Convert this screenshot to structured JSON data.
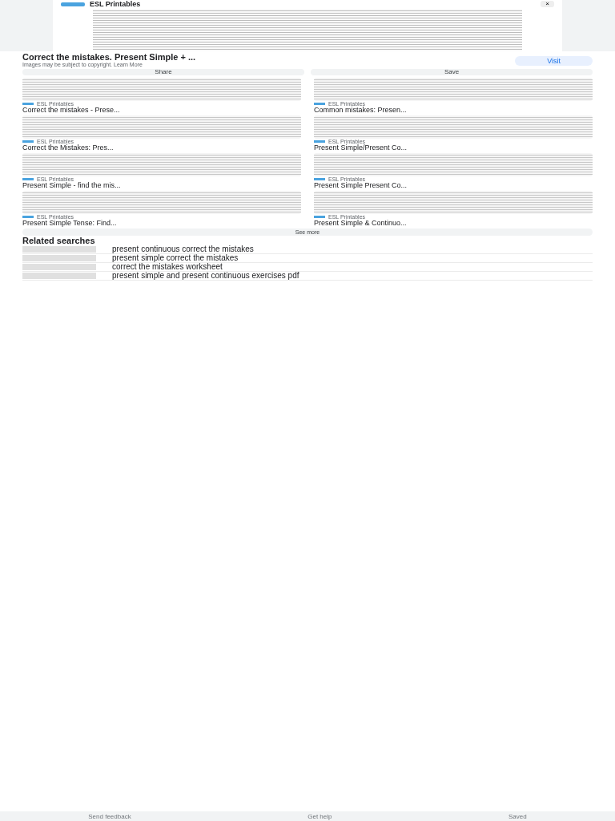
{
  "preview": {
    "source": "ESL Printables",
    "close": "×"
  },
  "result": {
    "title": "Correct the mistakes. Present Simple + ...",
    "notice": "Images may be subject to copyright.",
    "learn_more": "Learn More",
    "visit": "Visit",
    "share": "Share",
    "save": "Save"
  },
  "cards": [
    {
      "source": "ESL Printables",
      "title": "Correct the mistakes - Prese..."
    },
    {
      "source": "ESL Printables",
      "title": "Common mistakes: Presen..."
    },
    {
      "source": "ESL Printables",
      "title": "Correct the Mistakes: Pres..."
    },
    {
      "source": "ESL Printables",
      "title": "Present Simple/Present Co..."
    },
    {
      "source": "ESL Printables",
      "title": "Present Simple - find the mis..."
    },
    {
      "source": "ESL Printables",
      "title": "Present Simple Present Co..."
    },
    {
      "source": "ESL Printables",
      "title": "Present Simple Tense: Find..."
    },
    {
      "source": "ESL Printables",
      "title": "Present Simple & Continuo..."
    }
  ],
  "see_more": "See more",
  "related": {
    "heading": "Related searches",
    "items": [
      "present continuous correct the mistakes",
      "present simple correct the mistakes",
      "correct the mistakes worksheet",
      "present simple and present continuous exercises pdf"
    ]
  },
  "footer": [
    "Send feedback",
    "Get help",
    "Saved"
  ]
}
